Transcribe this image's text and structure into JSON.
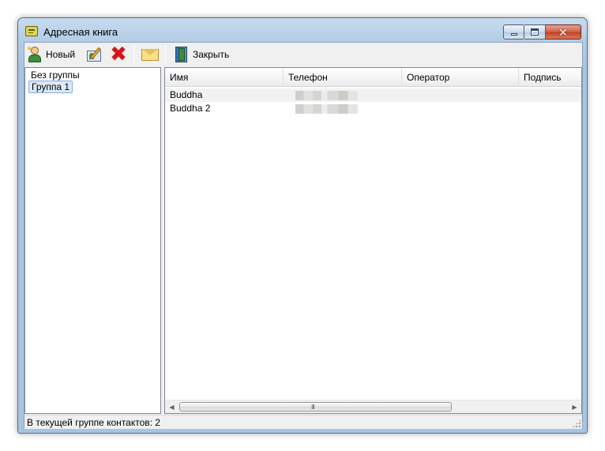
{
  "window": {
    "title": "Адресная книга",
    "close_glyph": "✕"
  },
  "toolbar": {
    "new_label": "Новый",
    "delete_glyph": "✖",
    "close_label": "Закрыть"
  },
  "groups": {
    "items": [
      "Без группы",
      "Группа 1"
    ],
    "selected_index": 1
  },
  "contacts": {
    "columns": [
      "Имя",
      "Телефон",
      "Оператор",
      "Подпись"
    ],
    "rows": [
      {
        "name": "Buddha",
        "phone_redacted": true,
        "operator": "",
        "signature": ""
      },
      {
        "name": "Buddha 2",
        "phone_redacted": true,
        "operator": "",
        "signature": ""
      }
    ],
    "scrollbar": {
      "left_arrow": "◀",
      "right_arrow": "▶",
      "grip": "III"
    }
  },
  "status": {
    "text": "В текущей группе контактов: 2"
  },
  "colors": {
    "selection": "#dbe9f8",
    "close_button": "#c43f20",
    "frame": "#b4cde6"
  }
}
